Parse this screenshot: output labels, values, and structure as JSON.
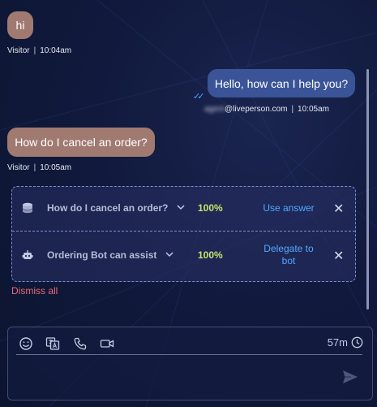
{
  "messages": [
    {
      "sender": "visitor",
      "text": "hi",
      "meta_name": "Visitor",
      "meta_time": "10:04am"
    },
    {
      "sender": "agent",
      "text": "Hello, how can I help you?",
      "meta_name": "agent@liveperson.com",
      "meta_name_blur": "agent",
      "meta_name_domain": "@liveperson.com",
      "meta_time": "10:05am",
      "status": "read"
    },
    {
      "sender": "visitor",
      "text": "How do I cancel an order?",
      "meta_name": "Visitor",
      "meta_time": "10:05am"
    }
  ],
  "suggestions": [
    {
      "icon": "database-icon",
      "text": "How do I cancel an order?",
      "confidence": "100%",
      "action": "Use answer"
    },
    {
      "icon": "bot-icon",
      "text": "Ordering Bot can assist",
      "confidence": "100%",
      "action": "Delegate to bot"
    }
  ],
  "dismiss_all": "Dismiss all",
  "composer": {
    "tools": [
      "emoji-icon",
      "translate-icon",
      "phone-icon",
      "video-icon"
    ],
    "timer": "57m",
    "placeholder": ""
  },
  "colors": {
    "visitor_bubble": "#a07a70",
    "agent_bubble": "#3a5497",
    "confidence": "#c8e26a",
    "action_link": "#52a8ff",
    "dismiss": "#e46b76"
  }
}
